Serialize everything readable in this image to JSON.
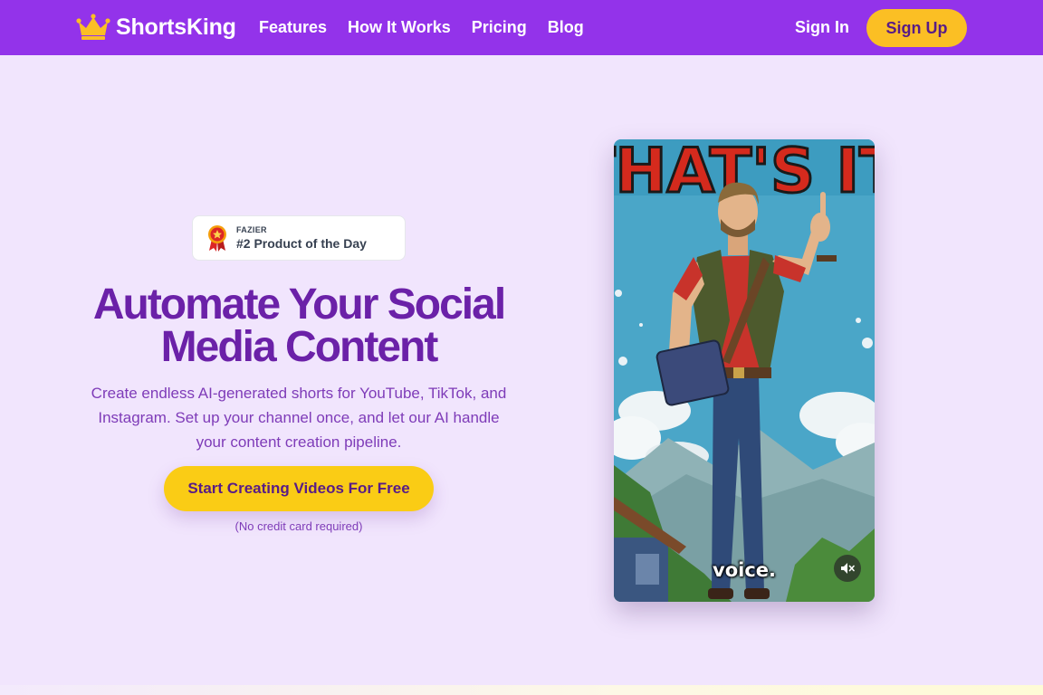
{
  "nav": {
    "brand": "ShortsKing",
    "links": [
      "Features",
      "How It Works",
      "Pricing",
      "Blog"
    ],
    "sign_in": "Sign In",
    "sign_up": "Sign Up"
  },
  "badge": {
    "kicker": "FAZIER",
    "title": "#2 Product of the Day",
    "icon": "award-ribbon-icon"
  },
  "hero": {
    "title_line1": "Automate Your Social",
    "title_line2": "Media Content",
    "subtitle": "Create endless AI-generated shorts for YouTube, TikTok, and Instagram. Set up your channel once, and let our AI handle your content creation pipeline.",
    "cta": "Start Creating Videos For Free",
    "note": "(No credit card required)"
  },
  "video": {
    "caption": "voice.",
    "banner_text": "THAT'S IT.",
    "mute_icon": "speaker-muted-icon"
  },
  "colors": {
    "nav_bg": "#9333ea",
    "page_bg": "#f1e5fd",
    "accent_yellow": "#facc15",
    "title_purple": "#6b21a8"
  }
}
